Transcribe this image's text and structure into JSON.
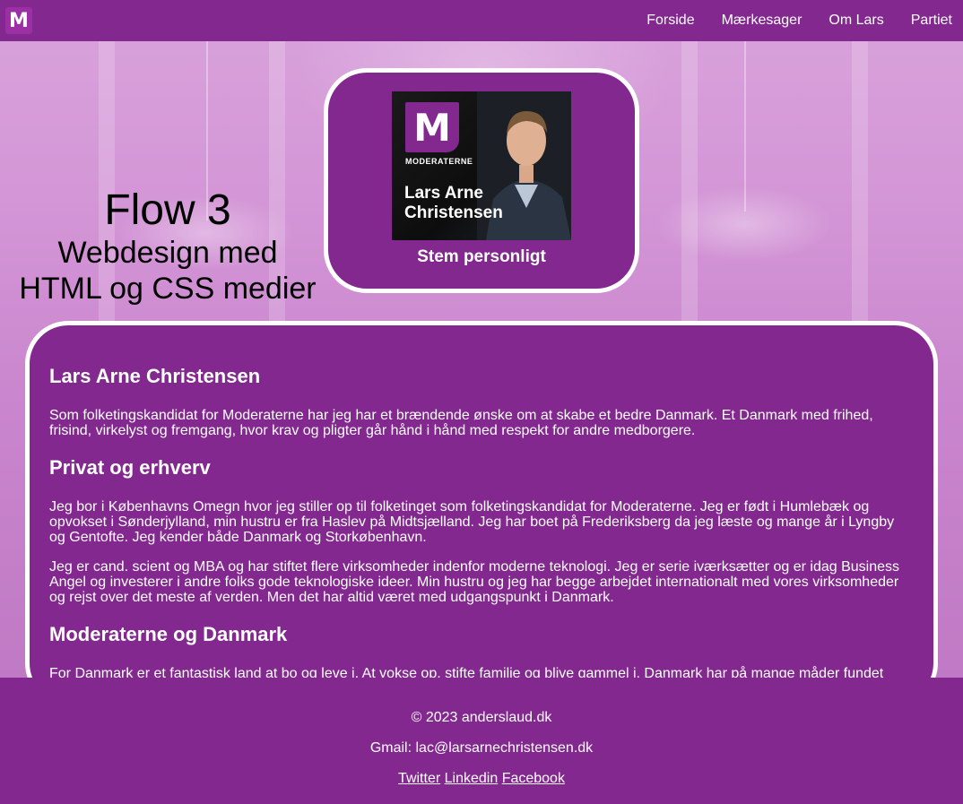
{
  "brand": {
    "logo_letter": "M"
  },
  "nav": {
    "items": [
      "Forside",
      "Mærkesager",
      "Om Lars",
      "Partiet"
    ]
  },
  "hero": {
    "title": "Flow 3",
    "subtitle_line1": "Webdesign med",
    "subtitle_line2": "HTML og CSS medier"
  },
  "poster": {
    "logo_letter": "M",
    "brand_text": "MODERATERNE",
    "name": "Lars Arne Christensen",
    "caption": "Stem personligt"
  },
  "content": {
    "h1": "Lars Arne Christensen",
    "p1": "Som folketingskandidat for Moderaterne har jeg har et brændende ønske om at skabe et bedre Danmark. Et Danmark med frihed, frisind, virkelyst og fremgang, hvor krav og pligter går hånd i hånd med respekt for andre medborgere.",
    "h2": "Privat og erhverv",
    "p2": "Jeg bor i Københavns Omegn hvor jeg stiller op til folketinget som folketingskandidat for Moderaterne. Jeg er født i Humlebæk og opvokset i Sønderjylland, min hustru er fra Haslev på Midtsjælland. Jeg har boet på Frederiksberg da jeg læste og mange år i Lyngby og Gentofte. Jeg kender både Danmark og Storkøbenhavn.",
    "p3": "Jeg er cand. scient og MBA og har stiftet flere virksomheder indenfor moderne teknologi. Jeg er serie iværksætter og er idag Business Angel og investerer i andre folks gode teknologiske ideer. Min hustru og jeg har begge arbejdet internationalt med vores virksomheder og rejst over det meste af verden. Men det har altid været med udgangspunkt i Danmark.",
    "h3": "Moderaterne og Danmark",
    "p4": "For Danmark er et fantastisk land at bo og leve i. At vokse op, stifte familie og blive gammel i. Danmark har på mange måder fundet"
  },
  "footer": {
    "copyright": "© 2023 anderslaud.dk",
    "email": "Gmail: lac@larsarnechristensen.dk",
    "links": [
      "Twitter",
      "Linkedin",
      "Facebook"
    ]
  },
  "colors": {
    "primary": "#82288e",
    "logo_bg": "#9c2fa3",
    "text_light": "#ffffff"
  }
}
